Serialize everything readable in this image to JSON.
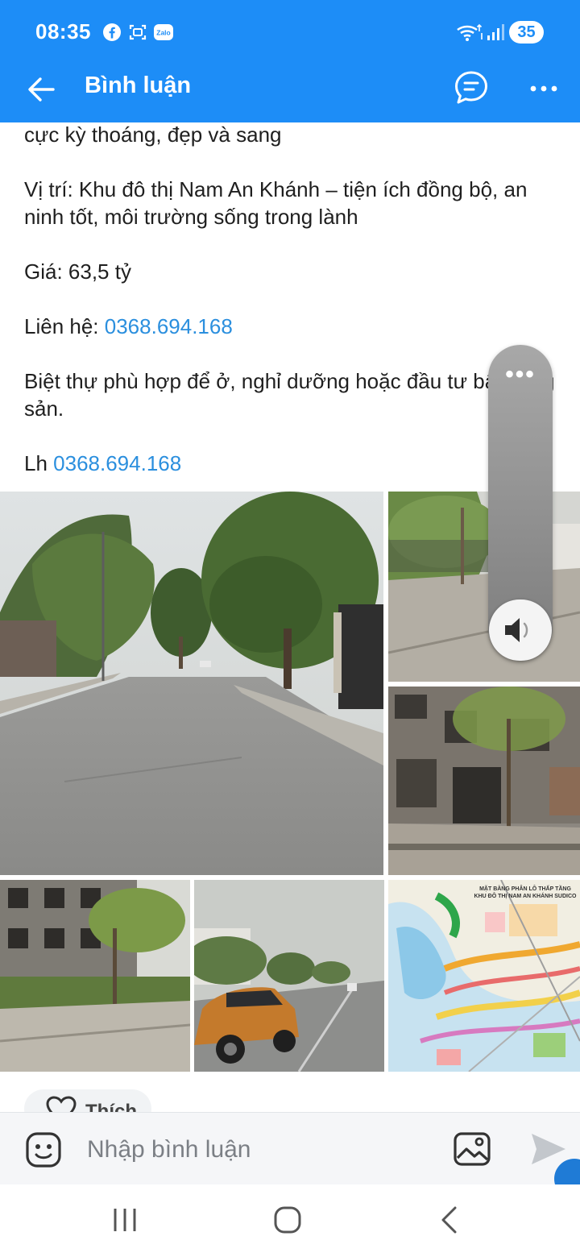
{
  "status_bar": {
    "time": "08:35",
    "battery": "35",
    "icons": [
      "facebook-icon",
      "screen-scan-icon",
      "zalo-icon",
      "wifi-icon",
      "signal-icon",
      "battery-icon"
    ],
    "zalo_badge": "Zalo"
  },
  "header": {
    "title": "Bình luận",
    "background": "#1d8df7",
    "icons": [
      "back-arrow-icon",
      "chat-bubble-icon",
      "more-horizontal-icon"
    ]
  },
  "post": {
    "lines": [
      {
        "text": "cực kỳ thoáng, đẹp và sang"
      },
      {
        "text": "Vị trí: Khu đô thị Nam An Khánh – tiện ích đồng bộ, an ninh tốt, môi trường sống trong lành"
      },
      {
        "text": "Giá: 63,5 tỷ"
      },
      {
        "label": "Liên hệ: ",
        "phone": "0368.694.168"
      },
      {
        "text": "Biệt thự phù hợp để ở, nghỉ dưỡng hoặc đầu tư bất động sản."
      },
      {
        "label": "Lh ",
        "phone": "0368.694.168"
      }
    ],
    "link_color": "#2b8fde"
  },
  "photo_overlay": {
    "map_title_line1": "MẶT BẰNG PHÂN LÔ THẤP TẦNG",
    "map_title_line2": "KHU ĐÔ THỊ NAM AN KHÁNH SUDICO"
  },
  "volume_panel": {
    "menu": "•••",
    "icons": [
      "speaker-icon"
    ]
  },
  "like": {
    "label": "Thích",
    "icons": [
      "heart-icon"
    ]
  },
  "comment_bar": {
    "placeholder": "Nhập bình luận",
    "icons": [
      "emoji-icon",
      "image-icon",
      "send-icon"
    ]
  },
  "system_nav": {
    "icons": [
      "recent-apps-icon",
      "home-icon",
      "back-icon"
    ]
  }
}
